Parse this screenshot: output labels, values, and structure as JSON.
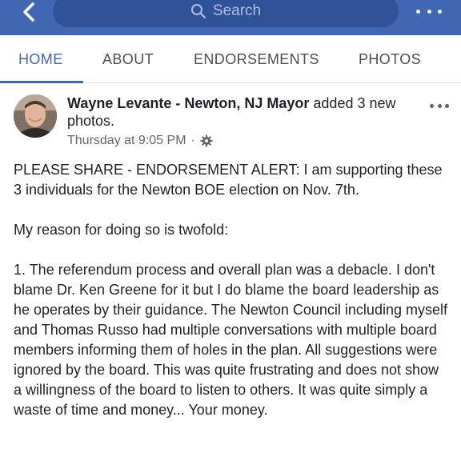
{
  "topbar": {
    "search_placeholder": "Search",
    "back_icon": "chevron-left-icon",
    "more_icon": "more-horizontal-icon",
    "bg_color": "#4267b2"
  },
  "tabs": [
    {
      "label": "HOME",
      "active": true
    },
    {
      "label": "ABOUT",
      "active": false
    },
    {
      "label": "ENDORSEMENTS",
      "active": false
    },
    {
      "label": "PHOTOS",
      "active": false
    }
  ],
  "post": {
    "author": "Wayne Levante - Newton, NJ Mayor",
    "action": " added 3 new photos.",
    "timestamp": "Thursday at 9:05 PM",
    "separator": "·",
    "privacy_icon": "gear-icon",
    "paragraphs": [
      "PLEASE SHARE - ENDORSEMENT ALERT: I am supporting these 3 individuals for the Newton BOE election on Nov. 7th.",
      "My reason for doing so is twofold:",
      "1.  The referendum process and overall plan was a debacle. I don't blame Dr. Ken Greene for it but I do blame the board leadership as he operates by their guidance. The Newton Council including myself and Thomas Russo had multiple conversations with multiple board members informing them of holes in the plan. All suggestions were ignored by the board. This was quite frustrating and does not show a willingness of the board to listen to others. It was quite simply a waste of time and money... Your money."
    ]
  }
}
